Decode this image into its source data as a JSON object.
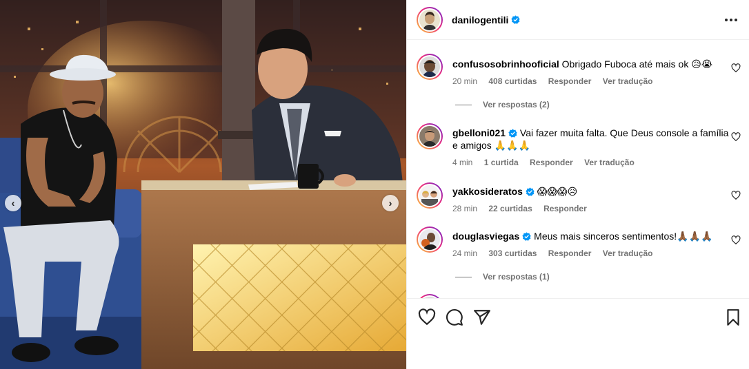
{
  "post": {
    "username": "danilogentili",
    "more_icon": "more-horizontal-icon"
  },
  "carousel": {
    "prev_icon": "chevron-left-icon",
    "next_icon": "chevron-right-icon",
    "prev_glyph": "‹",
    "next_glyph": "›"
  },
  "comments": [
    {
      "username": "confusosobrinhooficial",
      "verified": false,
      "text": "Obrigado Fuboca até mais ok 😥😭",
      "time": "20 min",
      "likes": "408 curtidas",
      "reply_label": "Responder",
      "translate_label": "Ver tradução",
      "replies": "Ver respostas (2)"
    },
    {
      "username": "gbelloni021",
      "verified": true,
      "text": "Vai fazer muita falta. Que Deus console a família e amigos 🙏🙏🙏",
      "time": "4 min",
      "likes": "1 curtida",
      "reply_label": "Responder",
      "translate_label": "Ver tradução"
    },
    {
      "username": "yakkosideratos",
      "verified": true,
      "text": "😱😱😱😥",
      "time": "28 min",
      "likes": "22 curtidas",
      "reply_label": "Responder"
    },
    {
      "username": "douglasviegas",
      "verified": true,
      "text": "Meus mais sinceros sentimentos!🙏🏾🙏🏾🙏🏾",
      "time": "24 min",
      "likes": "303 curtidas",
      "reply_label": "Responder",
      "translate_label": "Ver tradução",
      "replies": "Ver respostas (1)"
    }
  ],
  "actions": {
    "like_icon": "heart-icon",
    "comment_icon": "comment-icon",
    "share_icon": "send-icon",
    "save_icon": "bookmark-icon"
  },
  "colors": {
    "verified": "#0095f6",
    "meta_text": "#737373",
    "divider": "#efefef"
  }
}
